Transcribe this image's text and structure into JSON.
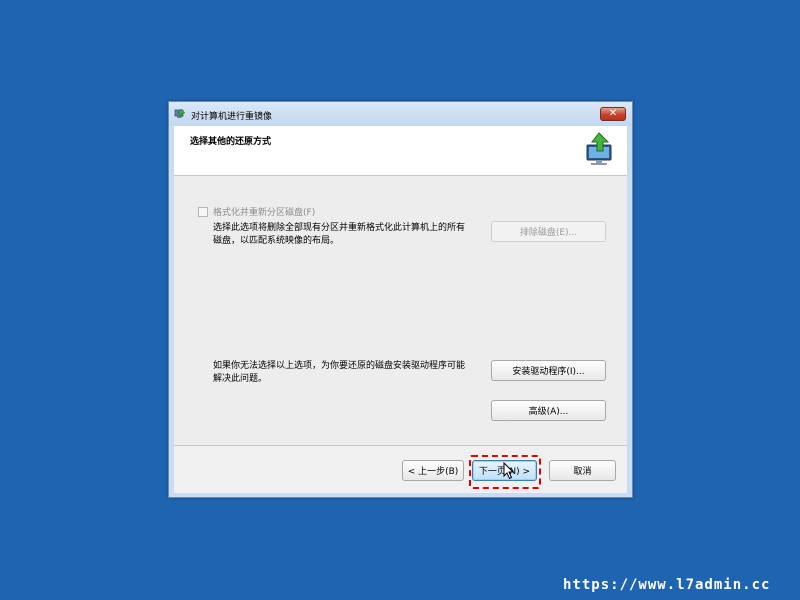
{
  "window": {
    "title": "对计算机进行重镜像",
    "close_label": "✕"
  },
  "header": {
    "title": "选择其他的还原方式"
  },
  "format_option": {
    "label": "格式化并重新分区磁盘(F)",
    "checked": false,
    "description_line1": "选择此选项将删除全部现有分区并重新格式化此计算机上的所有",
    "description_line2": "磁盘，以匹配系统映像的布局。",
    "exclude_disks_label": "排除磁盘(E)..."
  },
  "driver_section": {
    "description_line1": "如果你无法选择以上选项，为你要还原的磁盘安装驱动程序可能",
    "description_line2": "解决此问题。",
    "install_drivers_label": "安装驱动程序(I)...",
    "advanced_label": "高级(A)..."
  },
  "footer": {
    "back_label": "< 上一步(B)",
    "next_label": "下一页(N) >",
    "cancel_label": "取消"
  },
  "watermark": {
    "text": "https://www.l7admin.cc"
  },
  "colors": {
    "desktop": "#1f64b0",
    "highlight": "#e00000",
    "close_button": "#c7432e"
  }
}
